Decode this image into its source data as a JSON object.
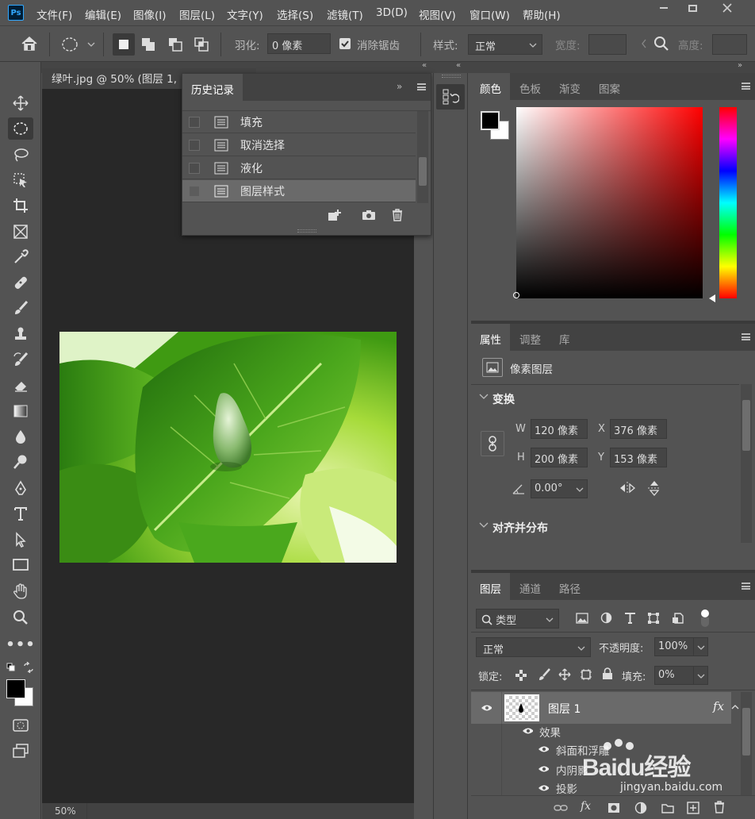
{
  "app": {
    "logo": "Ps"
  },
  "menu": [
    "文件(F)",
    "编辑(E)",
    "图像(I)",
    "图层(L)",
    "文字(Y)",
    "选择(S)",
    "滤镜(T)",
    "3D(D)",
    "视图(V)",
    "窗口(W)",
    "帮助(H)"
  ],
  "options": {
    "feather_label": "羽化:",
    "feather_value": "0 像素",
    "antialias_label": "消除锯齿",
    "style_label": "样式:",
    "style_value": "正常",
    "width_label": "宽度:",
    "height_label": "高度:"
  },
  "document": {
    "tab_title": "绿叶.jpg @ 50% (图层 1,",
    "zoom": "50%"
  },
  "history": {
    "title": "历史记录",
    "items": [
      "填充",
      "取消选择",
      "液化",
      "图层样式"
    ]
  },
  "color_panel": {
    "tabs": [
      "颜色",
      "色板",
      "渐变",
      "图案"
    ],
    "fg": "#000000",
    "bg": "#ffffff",
    "hue": "#ff0000"
  },
  "properties": {
    "tabs": [
      "属性",
      "调整",
      "库"
    ],
    "layer_type": "像素图层",
    "transform_title": "变换",
    "w_label": "W",
    "w_value": "120 像素",
    "x_label": "X",
    "x_value": "376 像素",
    "h_label": "H",
    "h_value": "200 像素",
    "y_label": "Y",
    "y_value": "153 像素",
    "angle_value": "0.00°",
    "align_title": "对齐并分布"
  },
  "layers": {
    "tabs": [
      "图层",
      "通道",
      "路径"
    ],
    "filter_kind": "类型",
    "blend_mode": "正常",
    "opacity_label": "不透明度:",
    "opacity_value": "100%",
    "lock_label": "锁定:",
    "fill_label": "填充:",
    "fill_value": "0%",
    "layer_name": "图层 1",
    "fx": "fx",
    "effects_label": "效果",
    "effects": [
      "斜面和浮雕",
      "内阴影",
      "投影"
    ]
  },
  "watermark": {
    "brand": "Baidu经验",
    "url": "jingyan.baidu.com"
  }
}
